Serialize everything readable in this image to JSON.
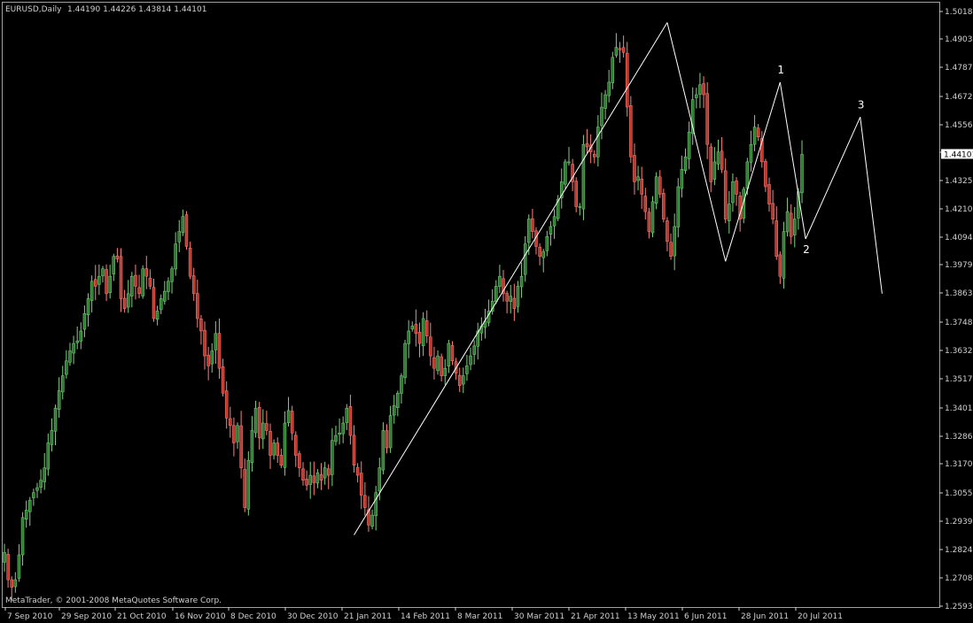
{
  "header": {
    "symbol": "EURUSD,Daily",
    "ohlc": "1.44190 1.44226 1.43814 1.44101"
  },
  "footer": {
    "copyright": "MetaTrader, © 2001-2008 MetaQuotes Software Corp."
  },
  "current_price_label": "1.44101",
  "colors": {
    "background": "#000000",
    "bull_body": "#2e7d32",
    "bull_wick": "#7fd17f",
    "bear_body": "#c0392b",
    "bear_wick": "#ff8080",
    "grid": "#3a3a3a",
    "axis": "#d0d0d0",
    "pattern_line": "#ffffff"
  },
  "chart_data": {
    "type": "candlestick",
    "symbol": "EURUSD",
    "timeframe": "Daily",
    "grid": false,
    "ylim": [
      1.259,
      1.502
    ],
    "y_ticks": [
      "1.50185",
      "1.49030",
      "1.47875",
      "1.46720",
      "1.45565",
      "1.44101",
      "1.43255",
      "1.42100",
      "1.40945",
      "1.39790",
      "1.38635",
      "1.37480",
      "1.36325",
      "1.35170",
      "1.34015",
      "1.32860",
      "1.31705",
      "1.30555",
      "1.29395",
      "1.28240",
      "1.27085",
      "1.25930"
    ],
    "x_ticks": [
      "7 Sep 2010",
      "29 Sep 2010",
      "21 Oct 2010",
      "16 Nov 2010",
      "8 Dec 2010",
      "30 Dec 2010",
      "21 Jan 2011",
      "14 Feb 2011",
      "8 Mar 2011",
      "30 Mar 2011",
      "21 Apr 2011",
      "13 May 2011",
      "6 Jun 2011",
      "28 Jun 2011",
      "20 Jul 2011"
    ],
    "closes": [
      1.281,
      1.27,
      1.267,
      1.27,
      1.28,
      1.295,
      1.298,
      1.302,
      1.305,
      1.307,
      1.31,
      1.315,
      1.325,
      1.33,
      1.339,
      1.346,
      1.352,
      1.358,
      1.362,
      1.365,
      1.366,
      1.37,
      1.377,
      1.383,
      1.39,
      1.388,
      1.392,
      1.395,
      1.385,
      1.392,
      1.4,
      1.399,
      1.383,
      1.379,
      1.385,
      1.392,
      1.388,
      1.385,
      1.395,
      1.392,
      1.388,
      1.375,
      1.378,
      1.383,
      1.386,
      1.39,
      1.395,
      1.405,
      1.41,
      1.416,
      1.404,
      1.392,
      1.385,
      1.375,
      1.37,
      1.36,
      1.356,
      1.362,
      1.369,
      1.355,
      1.345,
      1.335,
      1.332,
      1.325,
      1.332,
      1.315,
      1.299,
      1.318,
      1.33,
      1.339,
      1.327,
      1.333,
      1.33,
      1.32,
      1.325,
      1.32,
      1.316,
      1.333,
      1.338,
      1.329,
      1.32,
      1.315,
      1.31,
      1.308,
      1.312,
      1.309,
      1.313,
      1.31,
      1.315,
      1.312,
      1.326,
      1.328,
      1.329,
      1.333,
      1.339,
      1.328,
      1.316,
      1.312,
      1.304,
      1.299,
      1.292,
      1.296,
      1.305,
      1.315,
      1.33,
      1.323,
      1.336,
      1.34,
      1.345,
      1.352,
      1.365,
      1.37,
      1.372,
      1.369,
      1.365,
      1.375,
      1.368,
      1.36,
      1.355,
      1.36,
      1.352,
      1.355,
      1.365,
      1.358,
      1.353,
      1.348,
      1.352,
      1.356,
      1.36,
      1.364,
      1.37,
      1.372,
      1.374,
      1.378,
      1.382,
      1.388,
      1.392,
      1.385,
      1.382,
      1.384,
      1.379,
      1.388,
      1.392,
      1.405,
      1.415,
      1.41,
      1.404,
      1.4,
      1.402,
      1.408,
      1.412,
      1.416,
      1.423,
      1.43,
      1.438,
      1.438,
      1.43,
      1.42,
      1.42,
      1.445,
      1.444,
      1.442,
      1.44,
      1.452,
      1.46,
      1.465,
      1.47,
      1.48,
      1.484,
      1.483,
      1.482,
      1.46,
      1.44,
      1.43,
      1.432,
      1.425,
      1.418,
      1.41,
      1.422,
      1.432,
      1.425,
      1.415,
      1.406,
      1.4,
      1.412,
      1.428,
      1.435,
      1.44,
      1.45,
      1.463,
      1.465,
      1.469,
      1.465,
      1.445,
      1.43,
      1.438,
      1.442,
      1.435,
      1.415,
      1.421,
      1.43,
      1.425,
      1.415,
      1.427,
      1.438,
      1.445,
      1.452,
      1.448,
      1.438,
      1.428,
      1.421,
      1.415,
      1.4,
      1.392,
      1.41,
      1.418,
      1.408,
      1.415,
      1.426,
      1.441
    ],
    "pattern_points": [
      {
        "x": "Dec 2010",
        "y": 1.288
      },
      {
        "x": "Apr 2011",
        "y": 1.494
      },
      {
        "x": "May 2011",
        "y": 1.398
      },
      {
        "x": "Jun 2011",
        "y": 1.47
      },
      {
        "x": "Jun 2011",
        "y": 1.407
      },
      {
        "x": "Jul 2011",
        "y": 1.456
      },
      {
        "x": "Jul 2011",
        "y": 1.385
      }
    ],
    "pattern_labels": [
      "1",
      "2",
      "3"
    ]
  }
}
